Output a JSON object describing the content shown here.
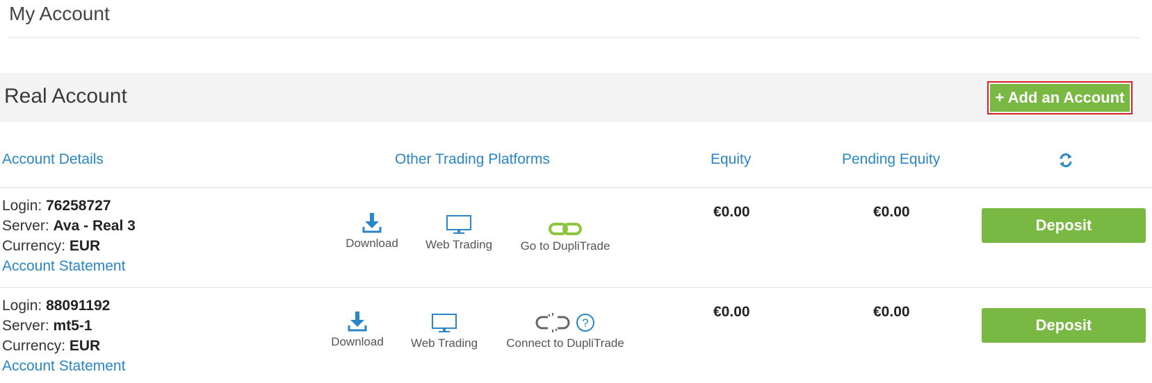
{
  "page": {
    "title": "My Account"
  },
  "section": {
    "title": "Real Account",
    "add_account_label": "+ Add an Account"
  },
  "table": {
    "headers": {
      "account_details": "Account Details",
      "other_platforms": "Other Trading Platforms",
      "equity": "Equity",
      "pending_equity": "Pending Equity"
    },
    "refresh_icon": "refresh-icon"
  },
  "labels": {
    "login": "Login:",
    "server": "Server:",
    "currency": "Currency:",
    "account_statement": "Account Statement",
    "download": "Download",
    "web_trading": "Web Trading",
    "deposit": "Deposit"
  },
  "accounts": [
    {
      "login": "76258727",
      "server": "Ava - Real 3",
      "currency": "EUR",
      "duplitrade_label": "Go to DupliTrade",
      "duplitrade_state": "linked",
      "equity": "€0.00",
      "pending_equity": "€0.00"
    },
    {
      "login": "88091192",
      "server": "mt5-1",
      "currency": "EUR",
      "duplitrade_label": "Connect to DupliTrade",
      "duplitrade_state": "unlinked",
      "equity": "€0.00",
      "pending_equity": "€0.00"
    }
  ],
  "colors": {
    "accent_blue": "#2a86c6",
    "brand_green": "#7ab844",
    "highlight_red": "#d9212a",
    "link_green": "#8cc63f"
  }
}
